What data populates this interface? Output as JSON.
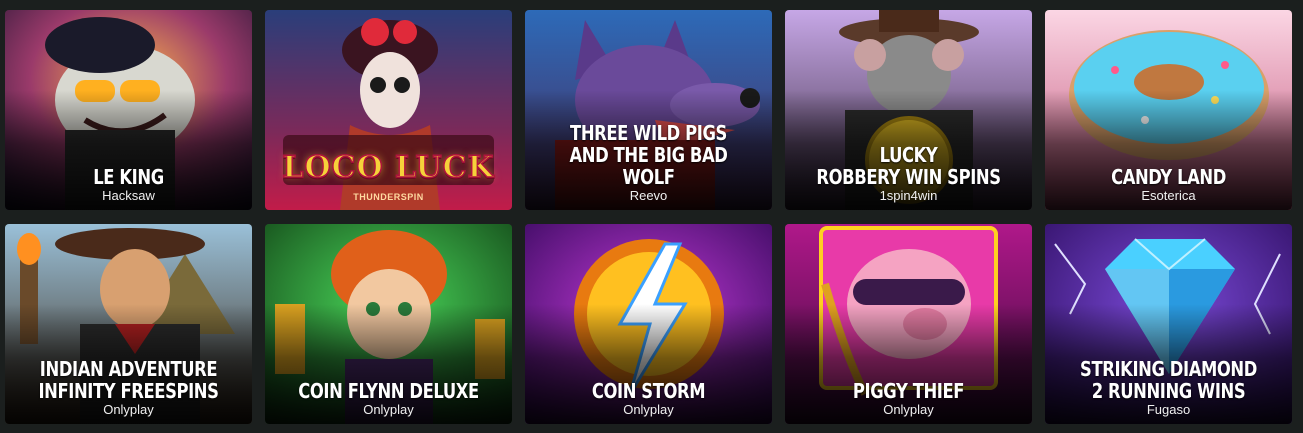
{
  "games": [
    {
      "title": "LE KING",
      "provider": "Hacksaw",
      "colors": [
        "#ff9e3d",
        "#6d2a52",
        "#1a1230"
      ]
    },
    {
      "title": "",
      "provider": "",
      "logo_text": "LOCO LUCK",
      "logo_brand": "THUNDERSPIN",
      "colors": [
        "#2a4a8a",
        "#8a2a4a",
        "#c21c49"
      ]
    },
    {
      "title": "THREE WILD PIGS\nAND THE BIG BAD WOLF",
      "provider": "Reevo",
      "colors": [
        "#2d6ab8",
        "#6a3c8e",
        "#7a1d1d"
      ]
    },
    {
      "title": "LUCKY\nROBBERY WIN SPINS",
      "provider": "1spin4win",
      "colors": [
        "#c6a7e6",
        "#7b5da8",
        "#3a2a40"
      ]
    },
    {
      "title": "CANDY LAND",
      "provider": "Esoterica",
      "colors": [
        "#f7b6d0",
        "#5ad0f0",
        "#c2547a"
      ]
    },
    {
      "title": "INDIAN ADVENTURE\nINFINITY FREESPINS",
      "provider": "Onlyplay",
      "colors": [
        "#9ac0d8",
        "#8a6a3a",
        "#3a2a1a"
      ]
    },
    {
      "title": "COIN FLYNN DELUXE",
      "provider": "Onlyplay",
      "colors": [
        "#3cc04a",
        "#1a7a2a",
        "#0e3a12"
      ]
    },
    {
      "title": "COIN STORM",
      "provider": "Onlyplay",
      "colors": [
        "#c23ad8",
        "#ffb020",
        "#3a0a60"
      ]
    },
    {
      "title": "PIGGY THIEF",
      "provider": "Onlyplay",
      "colors": [
        "#b0188a",
        "#f5a3c2",
        "#3a0a3a"
      ]
    },
    {
      "title": "STRIKING DIAMOND\n2 RUNNING WINS",
      "provider": "Fugaso",
      "colors": [
        "#5a2aa8",
        "#4ad0ff",
        "#2a0a5a"
      ]
    }
  ]
}
